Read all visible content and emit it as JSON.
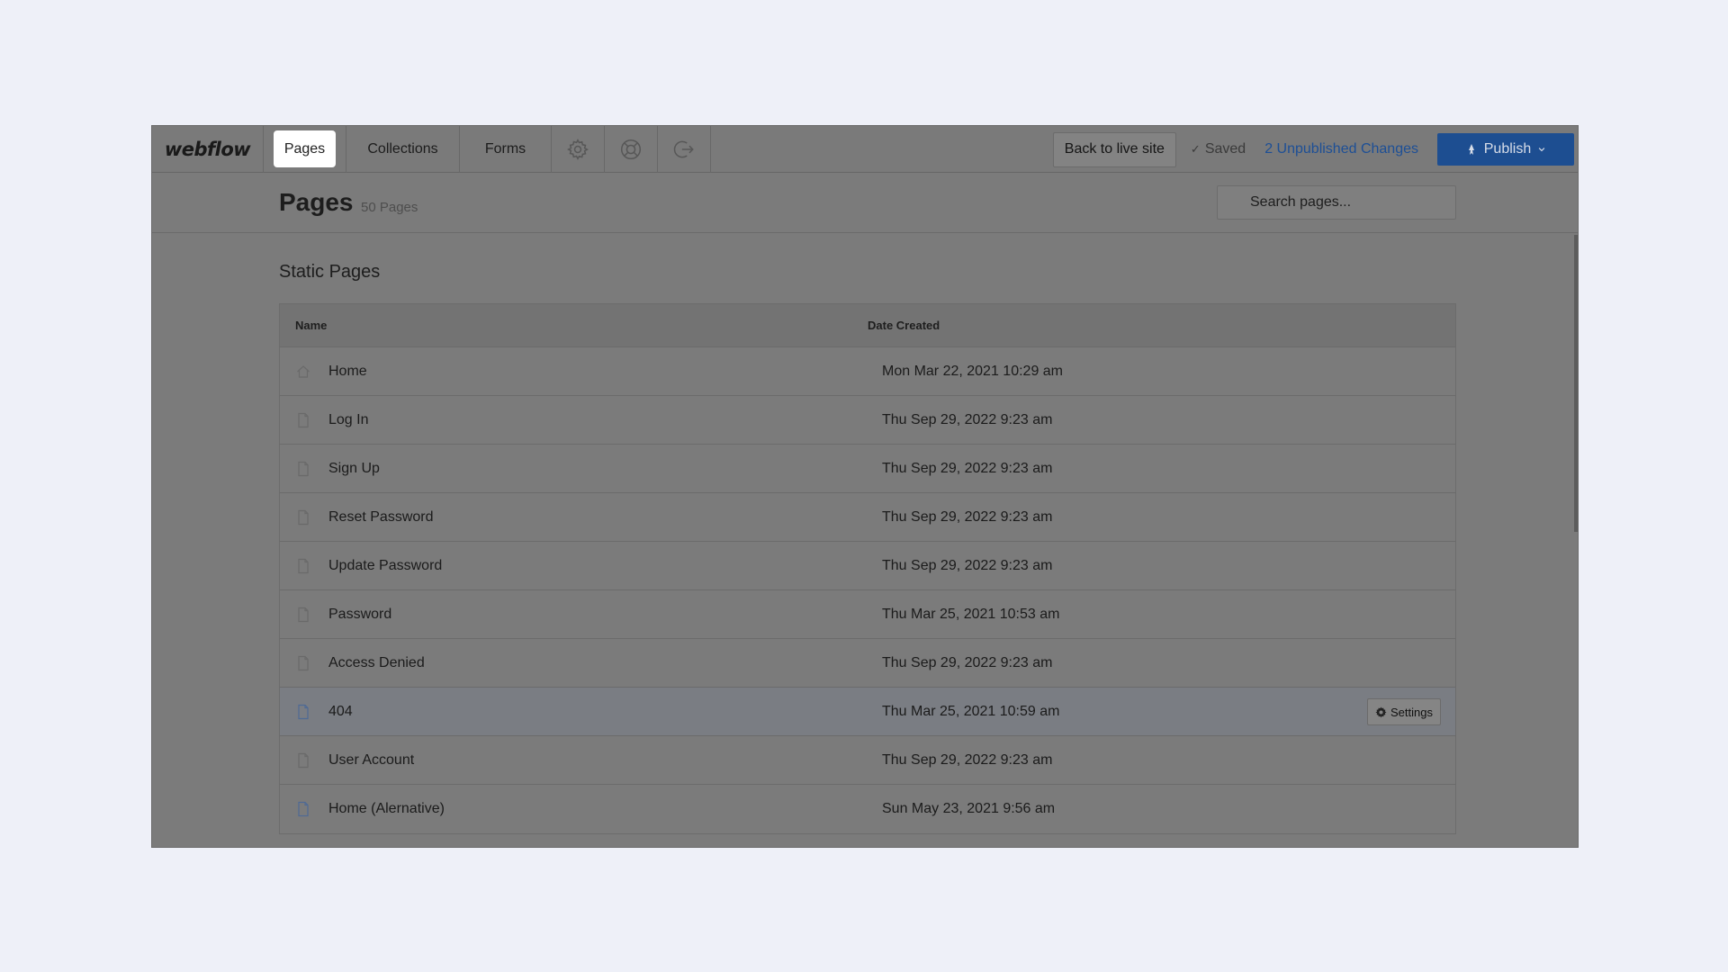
{
  "topbar": {
    "logo": "webflow",
    "tabs": [
      {
        "label": "Pages",
        "active": true
      },
      {
        "label": "Collections",
        "active": false
      },
      {
        "label": "Forms",
        "active": false
      }
    ],
    "icon_buttons": [
      "gear-icon",
      "help-circle-icon",
      "exit-icon"
    ],
    "back_label": "Back to live site",
    "saved_label": "Saved",
    "unpublished_label": "2 Unpublished Changes",
    "publish_label": "Publish"
  },
  "header": {
    "title": "Pages",
    "count": "50 Pages",
    "search_placeholder": "Search pages..."
  },
  "section": {
    "title": "Static Pages",
    "columns": {
      "name": "Name",
      "date": "Date Created"
    },
    "rows": [
      {
        "name": "Home",
        "date": "Mon Mar 22, 2021 10:29 am",
        "icon": "home-icon"
      },
      {
        "name": "Log In",
        "date": "Thu Sep 29, 2022 9:23 am",
        "icon": "page-icon"
      },
      {
        "name": "Sign Up",
        "date": "Thu Sep 29, 2022 9:23 am",
        "icon": "page-icon"
      },
      {
        "name": "Reset Password",
        "date": "Thu Sep 29, 2022 9:23 am",
        "icon": "page-icon"
      },
      {
        "name": "Update Password",
        "date": "Thu Sep 29, 2022 9:23 am",
        "icon": "page-icon"
      },
      {
        "name": "Password",
        "date": "Thu Mar 25, 2021 10:53 am",
        "icon": "page-icon"
      },
      {
        "name": "Access Denied",
        "date": "Thu Sep 29, 2022 9:23 am",
        "icon": "page-icon"
      },
      {
        "name": "404",
        "date": "Thu Mar 25, 2021 10:59 am",
        "icon": "page-icon"
      },
      {
        "name": "User Account",
        "date": "Thu Sep 29, 2022 9:23 am",
        "icon": "page-icon"
      },
      {
        "name": "Home (Alernative)",
        "date": "Sun May 23, 2021 9:56 am",
        "icon": "page-icon"
      }
    ],
    "settings_label": "Settings"
  },
  "colors": {
    "page_background": "#eef0f8",
    "overlay_gray": "#7b7b7b",
    "link_blue": "#1d4f96",
    "publish_blue": "#1d4e91"
  }
}
